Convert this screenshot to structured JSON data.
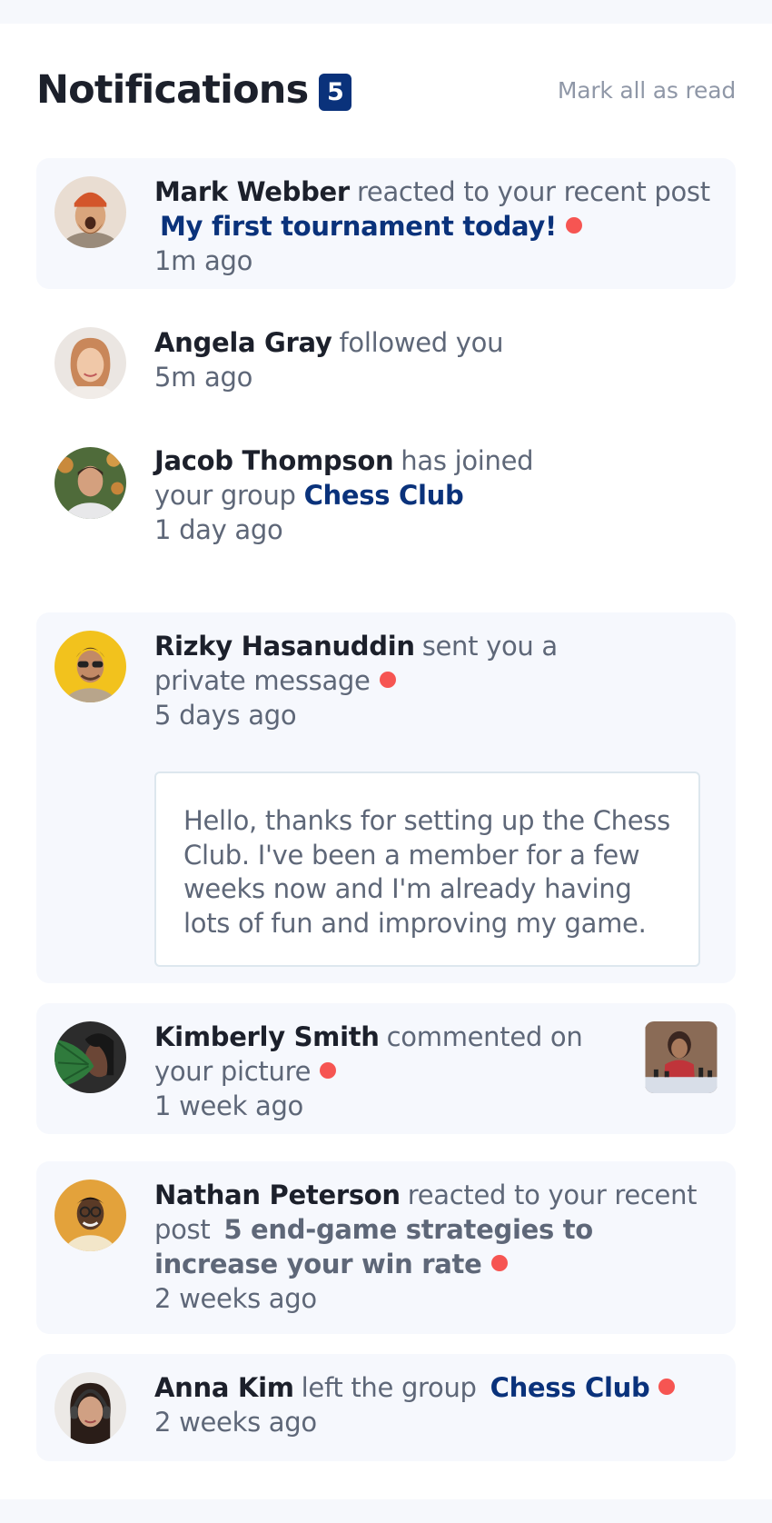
{
  "header": {
    "title": "Notifications",
    "count": "5",
    "mark_all": "Mark all as read"
  },
  "colors": {
    "accent": "#0a327b",
    "unread_dot": "#f65552",
    "unread_bg": "#f6f8fd",
    "text_dark": "#1c202b",
    "text_muted": "#5e6778"
  },
  "notifications": [
    {
      "name": "Mark Webber",
      "action": "reacted to your recent post",
      "target": "My first tournament today!",
      "time": "1m ago",
      "unread": true,
      "avatar_icon": "avatar-mark-webber"
    },
    {
      "name": "Angela Gray",
      "action": "followed you",
      "time": "5m ago",
      "unread": false,
      "avatar_icon": "avatar-angela-gray"
    },
    {
      "name": "Jacob Thompson",
      "action": "has joined your group",
      "target": "Chess Club",
      "time": "1 day ago",
      "unread": false,
      "avatar_icon": "avatar-jacob-thompson"
    },
    {
      "name": "Rizky Hasanuddin",
      "action": "sent you a private message",
      "time": "5 days ago",
      "unread": true,
      "message": "Hello, thanks for setting up the Chess Club. I've been a member for a few weeks now and I'm already having lots of fun and improving my game.",
      "avatar_icon": "avatar-rizky-hasanuddin"
    },
    {
      "name": "Kimberly Smith",
      "action": "commented on your picture",
      "time": "1 week ago",
      "unread": true,
      "avatar_icon": "avatar-kimberly-smith",
      "thumbnail_icon": "chess-picture-thumbnail"
    },
    {
      "name": "Nathan Peterson",
      "action": "reacted to your recent post",
      "target": "5 end-game strategies to increase your win rate",
      "time": "2 weeks ago",
      "unread": true,
      "avatar_icon": "avatar-nathan-peterson"
    },
    {
      "name": "Anna Kim",
      "action": "left the group",
      "target": "Chess Club",
      "time": "2 weeks ago",
      "unread": true,
      "avatar_icon": "avatar-anna-kim"
    }
  ]
}
